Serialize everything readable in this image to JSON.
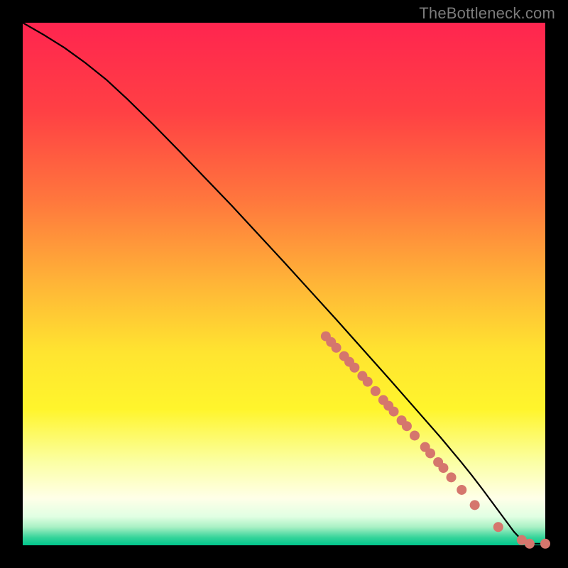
{
  "attribution": "TheBottleneck.com",
  "chart_data": {
    "type": "line",
    "title": "",
    "xlabel": "",
    "ylabel": "",
    "xlim": [
      0,
      100
    ],
    "ylim": [
      0,
      100
    ],
    "grid": false,
    "background_gradient": {
      "stops": [
        {
          "offset": 0.0,
          "color": "#ff254f"
        },
        {
          "offset": 0.17,
          "color": "#ff4044"
        },
        {
          "offset": 0.34,
          "color": "#ff773d"
        },
        {
          "offset": 0.5,
          "color": "#ffb537"
        },
        {
          "offset": 0.63,
          "color": "#ffe430"
        },
        {
          "offset": 0.74,
          "color": "#fff52c"
        },
        {
          "offset": 0.84,
          "color": "#fbffa3"
        },
        {
          "offset": 0.91,
          "color": "#ffffe8"
        },
        {
          "offset": 0.945,
          "color": "#e1ffe3"
        },
        {
          "offset": 0.965,
          "color": "#a9f0c4"
        },
        {
          "offset": 0.985,
          "color": "#36d49a"
        },
        {
          "offset": 1.0,
          "color": "#00c68c"
        }
      ]
    },
    "series": [
      {
        "name": "bottleneck-curve",
        "type": "line",
        "color": "#000000",
        "x": [
          0,
          4,
          8,
          12,
          16,
          20,
          25,
          30,
          35,
          40,
          45,
          50,
          55,
          60,
          65,
          70,
          75,
          80,
          84,
          86,
          88,
          90,
          92,
          94,
          95.5,
          97,
          100
        ],
        "y": [
          100,
          97.7,
          95.2,
          92.3,
          89.1,
          85.4,
          80.5,
          75.4,
          70.2,
          65.0,
          59.6,
          54.2,
          48.7,
          43.2,
          37.6,
          32.0,
          26.3,
          20.6,
          15.8,
          13.3,
          10.7,
          8.0,
          5.3,
          2.6,
          1.0,
          0.3,
          0.3
        ]
      },
      {
        "name": "bottleneck-points",
        "type": "scatter",
        "color": "#d5766d",
        "radius": 7,
        "x": [
          58.0,
          59.0,
          60.0,
          61.5,
          62.5,
          63.5,
          65.0,
          66.0,
          67.5,
          69.0,
          70.0,
          71.0,
          72.5,
          73.5,
          75.0,
          77.0,
          78.0,
          79.5,
          80.5,
          82.0,
          84.0,
          86.5,
          91.0,
          95.5,
          97.0,
          100.0
        ],
        "y": [
          40.0,
          38.9,
          37.8,
          36.2,
          35.1,
          34.0,
          32.4,
          31.3,
          29.5,
          27.8,
          26.7,
          25.6,
          23.9,
          22.8,
          21.0,
          18.8,
          17.6,
          15.9,
          14.8,
          13.0,
          10.6,
          7.7,
          3.5,
          1.0,
          0.3,
          0.3
        ]
      }
    ]
  }
}
